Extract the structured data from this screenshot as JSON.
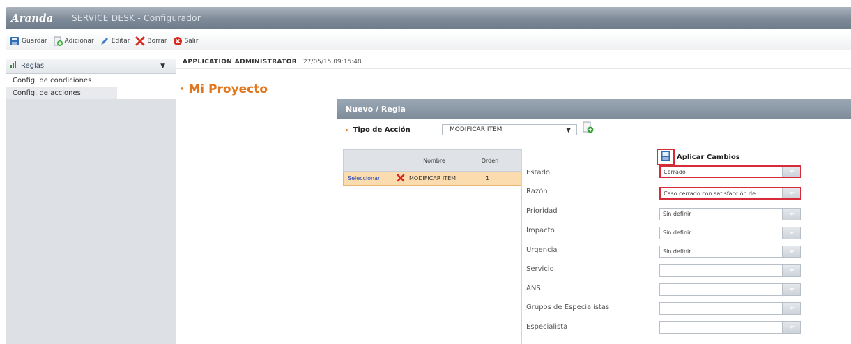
{
  "app": {
    "brand": "Aranda",
    "subtitle": "SERVICE DESK - Configurador"
  },
  "toolbar": {
    "buttons": [
      {
        "label": "Guardar",
        "icon": "save-icon"
      },
      {
        "label": "Adicionar",
        "icon": "add-icon"
      },
      {
        "label": "Editar",
        "icon": "edit-icon"
      },
      {
        "label": "Borrar",
        "icon": "delete-icon"
      },
      {
        "label": "Salir",
        "icon": "exit-icon"
      }
    ]
  },
  "sidebar": {
    "header": "Reglas",
    "items": [
      {
        "label": "Config. de condiciones"
      },
      {
        "label": "Config. de acciones"
      }
    ]
  },
  "user": {
    "name": "APPLICATION ADMINISTRATOR",
    "timestamp": "27/05/15 09:15:48"
  },
  "project": {
    "title": "Mi Proyecto"
  },
  "panel": {
    "title": "Nuevo / Regla",
    "action_type_label": "Tipo de Acción",
    "action_type_value": "MODIFICAR ITEM",
    "grid": {
      "headers": [
        "",
        "Nombre",
        "Orden"
      ],
      "rows": [
        {
          "select": "Seleccionar",
          "name": "MODIFICAR ITEM",
          "order": "1"
        }
      ]
    },
    "apply_label": "Aplicar Cambios",
    "fields": [
      {
        "label": "Estado",
        "value": "Cerrado"
      },
      {
        "label": "Razón",
        "value": "Caso cerrado con satisfacción de"
      },
      {
        "label": "Prioridad",
        "value": "Sin definir"
      },
      {
        "label": "Impacto",
        "value": "Sin definir"
      },
      {
        "label": "Urgencia",
        "value": "Sin definir"
      },
      {
        "label": "Servicio",
        "value": ""
      },
      {
        "label": "ANS",
        "value": ""
      },
      {
        "label": "Grupos de Especialistas",
        "value": ""
      },
      {
        "label": "Especialista",
        "value": ""
      }
    ]
  },
  "colors": {
    "accent": "#e2761c",
    "highlight": "#d62b38",
    "selected_row": "#fbdcae",
    "header_bar": "#7f8c9a"
  }
}
